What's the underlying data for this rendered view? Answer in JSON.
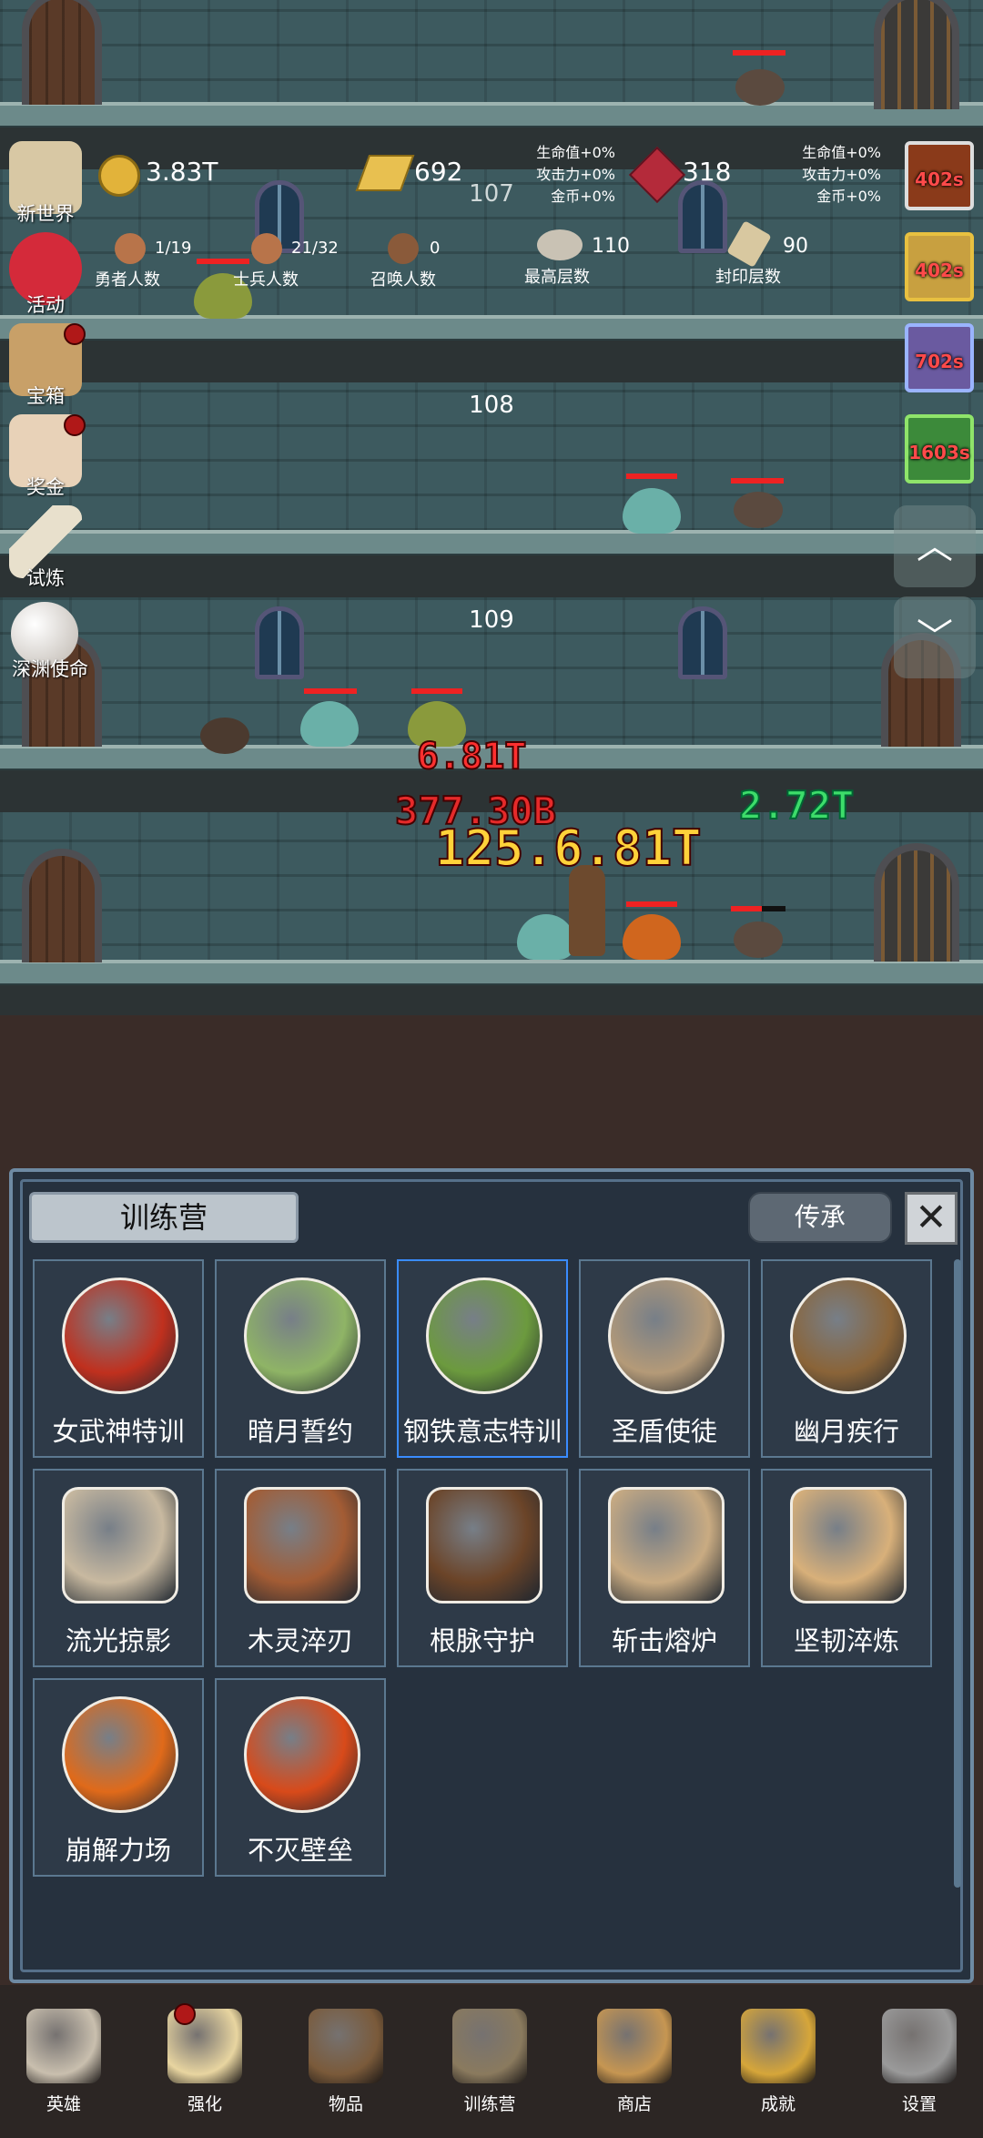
{
  "resources": {
    "gold": "3.83T",
    "gold_bar": "692",
    "ruby": "318",
    "floor_top": "107"
  },
  "bonus_left": [
    "生命值+0%",
    "攻击力+0%",
    "金币+0%"
  ],
  "bonus_right": [
    "生命值+0%",
    "攻击力+0%",
    "金币+0%"
  ],
  "stats": [
    {
      "value": "1/19",
      "label": "勇者人数"
    },
    {
      "value": "21/32",
      "label": "士兵人数"
    },
    {
      "value": "0",
      "label": "召唤人数"
    },
    {
      "value": "110",
      "label": "最高层数"
    },
    {
      "value": "90",
      "label": "封印层数"
    }
  ],
  "left_menu": [
    {
      "label": "新世界",
      "icon": "map-scroll-icon",
      "badge": false
    },
    {
      "label": "活动",
      "icon": "heart-icon",
      "badge": false
    },
    {
      "label": "宝箱",
      "icon": "chest-icon",
      "badge": true
    },
    {
      "label": "奖金",
      "icon": "envelope-icon",
      "badge": true
    },
    {
      "label": "试炼",
      "icon": "feather-icon",
      "badge": false
    },
    {
      "label": "深渊使命",
      "icon": "pearl-icon",
      "badge": false
    }
  ],
  "timers": [
    "402s",
    "402s",
    "702s",
    "1603s"
  ],
  "floors": [
    "108",
    "109"
  ],
  "damage": {
    "a": "6.81T",
    "b": "377.30B",
    "c": "125.6.81T",
    "heal": "2.72T"
  },
  "panel": {
    "title": "训练营",
    "legacy_button": "传承",
    "close": "✕"
  },
  "items": [
    {
      "label": "女武神特训",
      "icon": "apple-icon",
      "color": "#c0301e"
    },
    {
      "label": "暗月誓约",
      "icon": "cabbage-icon",
      "color": "#8fb466"
    },
    {
      "label": "钢铁意志特训",
      "icon": "leaf-icon",
      "color": "#6c9a3e",
      "selected": true
    },
    {
      "label": "圣盾使徒",
      "icon": "bowl-icon",
      "color": "#b49a78"
    },
    {
      "label": "幽月疾行",
      "icon": "acorn-icon",
      "color": "#8a6438"
    },
    {
      "label": "流光掠影",
      "icon": "fish-bone-icon",
      "color": "#c8b9a0"
    },
    {
      "label": "木灵淬刃",
      "icon": "log-icon",
      "color": "#a35c34"
    },
    {
      "label": "根脉守护",
      "icon": "wooden-shield-icon",
      "color": "#6b4428"
    },
    {
      "label": "斩击熔炉",
      "icon": "crate-icon",
      "color": "#c9ab82"
    },
    {
      "label": "坚韧淬炼",
      "icon": "banded-shield-icon",
      "color": "#d8b07a"
    },
    {
      "label": "崩解力场",
      "icon": "lava-orb-icon",
      "color": "#e06a1a"
    },
    {
      "label": "不灭壁垒",
      "icon": "sun-orb-icon",
      "color": "#d84a1a"
    }
  ],
  "nav": [
    {
      "label": "英雄",
      "icon": "skull-icon",
      "color": "#c9bfae",
      "badge": false
    },
    {
      "label": "强化",
      "icon": "candle-icon",
      "color": "#e8d5a0",
      "badge": true
    },
    {
      "label": "物品",
      "icon": "book-icon",
      "color": "#7a5a3a",
      "badge": false
    },
    {
      "label": "训练营",
      "icon": "lantern-icon",
      "color": "#8a7a5e",
      "badge": false
    },
    {
      "label": "商店",
      "icon": "beer-mug-icon",
      "color": "#c69652",
      "badge": false
    },
    {
      "label": "成就",
      "icon": "key-icon",
      "color": "#d6a63a",
      "badge": false
    },
    {
      "label": "设置",
      "icon": "gear-icon",
      "color": "#9a9a9a",
      "badge": false
    }
  ]
}
